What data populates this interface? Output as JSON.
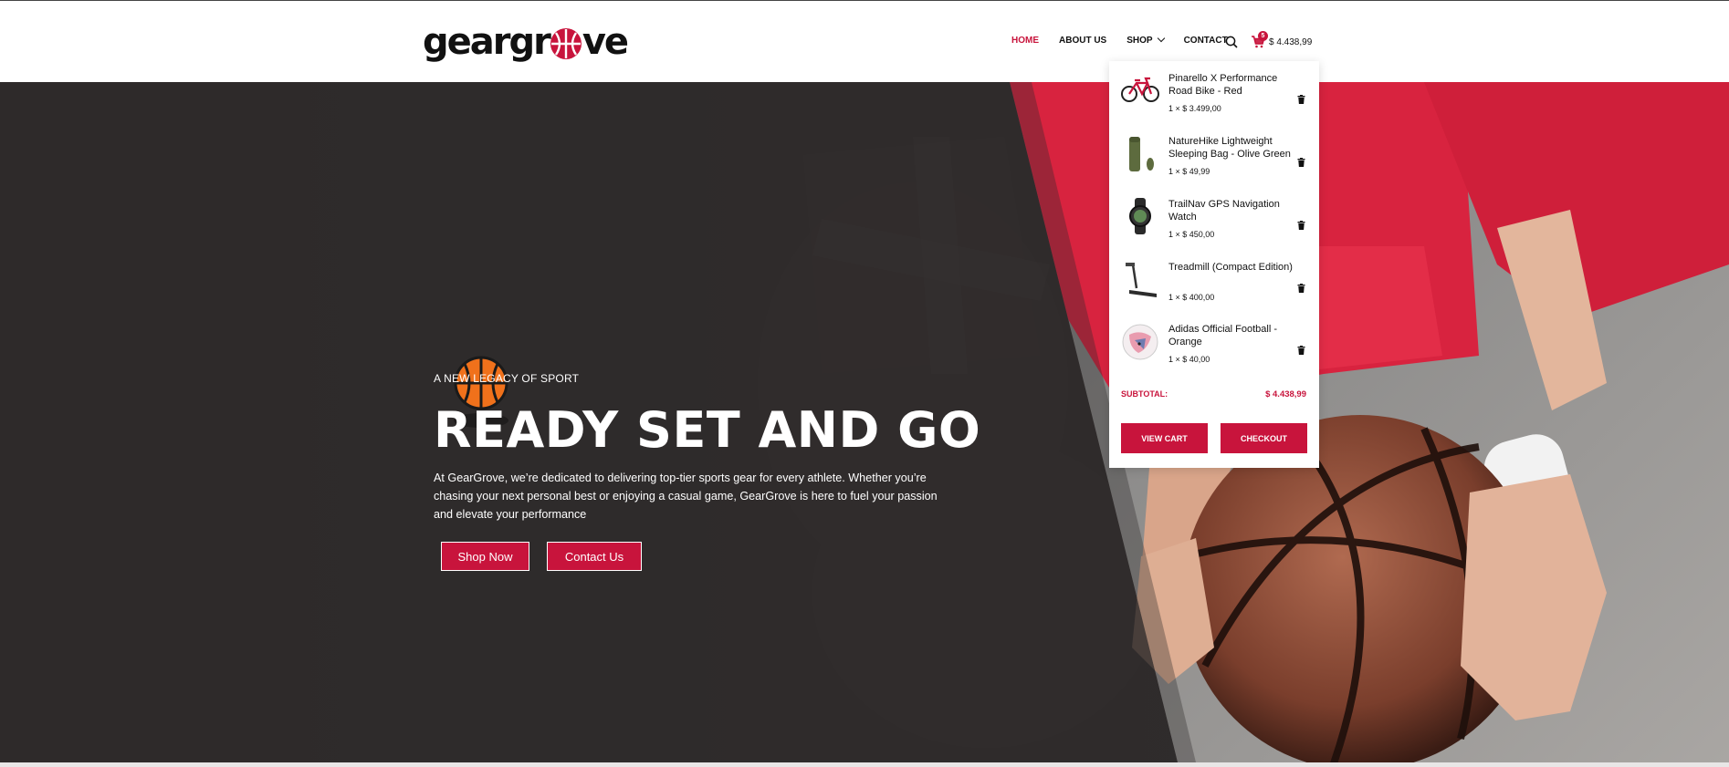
{
  "logo": {
    "part1": "geargr",
    "part2": "ve"
  },
  "nav": {
    "home": "HOME",
    "about": "ABOUT US",
    "shop": "SHOP",
    "contact": "CONTACT"
  },
  "header_cart": {
    "count": "5",
    "total": "$ 4.438,99"
  },
  "hero": {
    "eyebrow": "A NEW LEGACY OF SPORT",
    "headline": "READY SET AND GO",
    "description": "At GearGrove, we’re dedicated to delivering top-tier sports gear for every athlete. Whether you’re chasing your next personal best or enjoying a casual game, GearGrove is here to fuel your passion and elevate your performance",
    "shop_button": "Shop Now",
    "contact_button": "Contact Us"
  },
  "cart": {
    "items": [
      {
        "name": "Pinarello X Performance Road Bike - Red",
        "qty": "1 × $ 3.499,00",
        "icon": "bike-thumbnail"
      },
      {
        "name": "NatureHike Lightweight Sleeping Bag - Olive Green",
        "qty": "1 × $ 49,99",
        "icon": "sleeping-bag-thumbnail"
      },
      {
        "name": "TrailNav GPS Navigation Watch",
        "qty": "1 × $ 450,00",
        "icon": "watch-thumbnail"
      },
      {
        "name": "Treadmill (Compact Edition)",
        "qty": "1 × $ 400,00",
        "icon": "treadmill-thumbnail"
      },
      {
        "name": "Adidas Official Football - Orange",
        "qty": "1 × $ 40,00",
        "icon": "football-thumbnail"
      }
    ],
    "subtotal_label": "SUBTOTAL:",
    "subtotal_value": "$ 4.438,99",
    "view_cart": "VIEW CART",
    "checkout": "CHECKOUT"
  },
  "colors": {
    "brand": "#c8143c",
    "hero_bg": "#2e2b2b"
  }
}
